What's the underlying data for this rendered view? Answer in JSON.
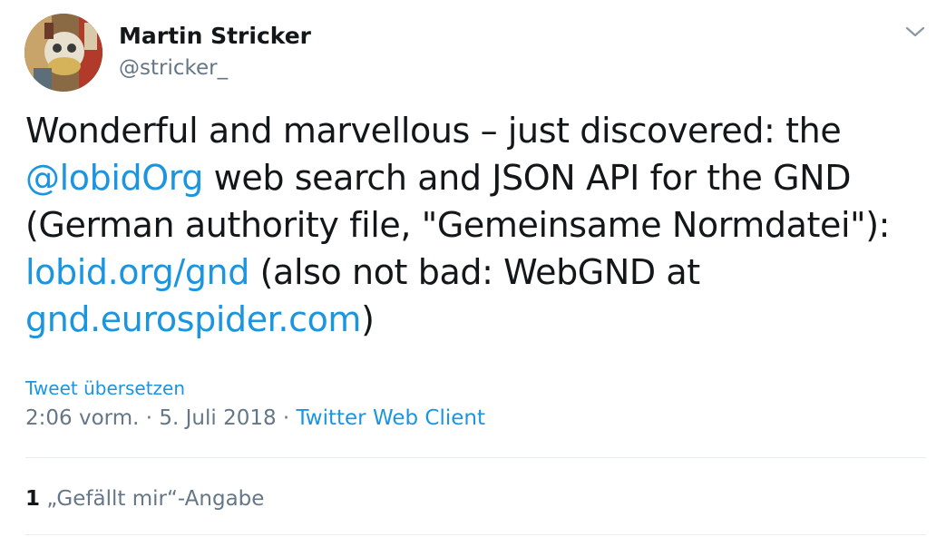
{
  "author": {
    "name": "Martin Stricker",
    "handle": "@stricker_"
  },
  "tweet": {
    "line1": "Wonderful and marvellous – just discovered: the",
    "mention": "@lobidOrg",
    "line2_rest": " web search and JSON API for the GND",
    "line3": "(German authority file, \"Gemeinsame Normdatei\"):",
    "link1": "lobid.org/gnd",
    "line4_rest": " (also not bad: WebGND at",
    "link2": "gnd.eurospider.com",
    "line5_rest": ")"
  },
  "translate_label": "Tweet übersetzen",
  "meta": {
    "time": "2:06 vorm.",
    "sep1": " · ",
    "date": "5. Juli 2018",
    "sep2": " · ",
    "source": "Twitter Web Client"
  },
  "stats": {
    "likes_count": "1",
    "likes_label": " „Gefällt mir“-Angabe"
  },
  "icons": {
    "menu": "chevron-down-icon"
  },
  "colors": {
    "link": "#1b95e0",
    "secondary_text": "#657786",
    "primary_text": "#14171a",
    "divider": "#e6ecf0"
  }
}
